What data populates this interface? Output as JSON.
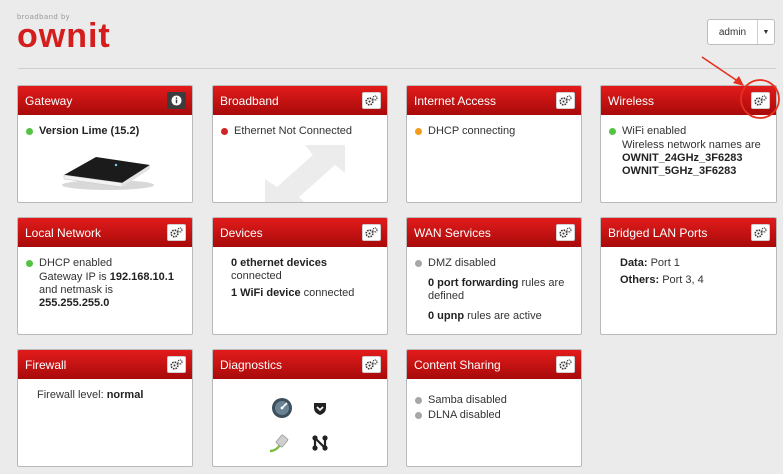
{
  "header": {
    "logo_top": "broadband by",
    "logo_main": "ownit",
    "user": "admin"
  },
  "cards": {
    "gateway": {
      "title": "Gateway",
      "version": "Version Lime (15.2)"
    },
    "broadband": {
      "title": "Broadband",
      "status": "Ethernet Not Connected"
    },
    "internet": {
      "title": "Internet Access",
      "status": "DHCP connecting"
    },
    "wireless": {
      "title": "Wireless",
      "status": "WiFi enabled",
      "names_label": "Wireless network names are",
      "ssid_24": "OWNIT_24GHz_3F6283",
      "ssid_5": "OWNIT_5GHz_3F6283"
    },
    "local": {
      "title": "Local Network",
      "status": "DHCP enabled",
      "ip_prefix": "Gateway IP is",
      "ip": "192.168.10.1",
      "mask_prefix": "and netmask is",
      "mask": "255.255.255.0"
    },
    "devices": {
      "title": "Devices",
      "eth_count": "0 ethernet devices",
      "eth_suffix": "connected",
      "wifi_count": "1 WiFi device",
      "wifi_suffix": "connected"
    },
    "wan": {
      "title": "WAN Services",
      "dmz": "DMZ disabled",
      "pf_count": "0 port forwarding",
      "pf_suffix": "rules are defined",
      "upnp_count": "0 upnp",
      "upnp_suffix": "rules are active"
    },
    "bridged": {
      "title": "Bridged LAN Ports",
      "data_label": "Data:",
      "data_value": "Port 1",
      "others_label": "Others:",
      "others_value": "Port 3, 4"
    },
    "firewall": {
      "title": "Firewall",
      "level_label": "Firewall level:",
      "level": "normal"
    },
    "diagnostics": {
      "title": "Diagnostics"
    },
    "sharing": {
      "title": "Content Sharing",
      "samba": "Samba disabled",
      "dlna": "DLNA disabled"
    }
  },
  "icons": {
    "settings": "gears-icon",
    "info": "info-icon"
  },
  "colors": {
    "header_red": "#d41e1e",
    "ok": "#54c243",
    "error": "#d12525",
    "pending": "#f29b1d",
    "disabled": "#a6a6a6",
    "annotation": "#e8301f"
  }
}
